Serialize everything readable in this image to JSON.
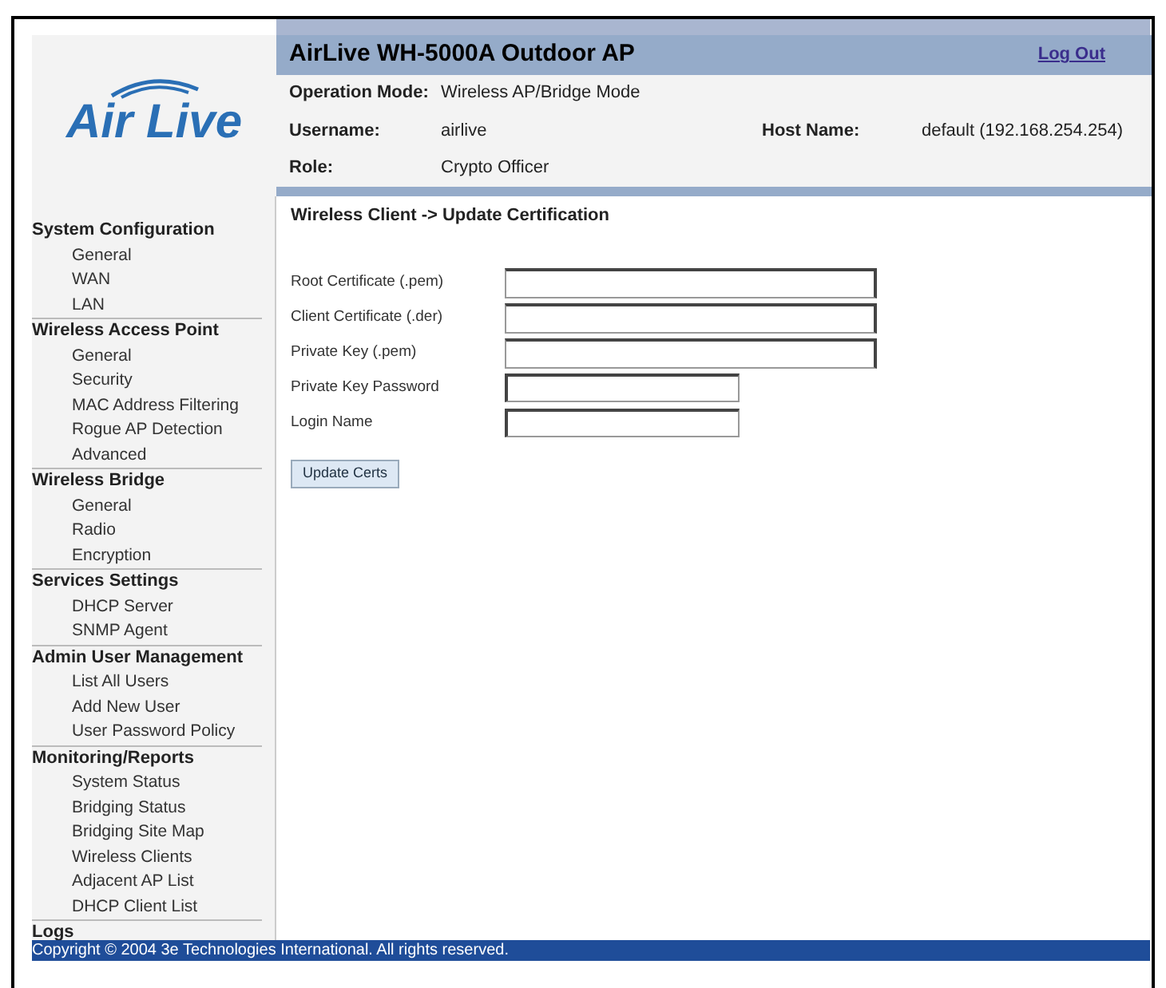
{
  "header": {
    "logo": "Air Live",
    "title": "AirLive WH-5000A  Outdoor AP",
    "logout": "Log Out",
    "info": [
      {
        "label": "Operation Mode:",
        "value": "Wireless AP/Bridge Mode"
      },
      {
        "label": "Username:",
        "value": "airlive",
        "label2": "Host Name:",
        "value2": "default (192.168.254.254)"
      },
      {
        "label": "Role:",
        "value": "Crypto Officer"
      }
    ]
  },
  "sidebar": [
    {
      "title": "System Configuration",
      "items": [
        "General",
        "WAN",
        "LAN"
      ]
    },
    {
      "title": "Wireless Access Point",
      "items": [
        "General",
        "Security",
        "MAC Address Filtering",
        "Rogue AP Detection",
        "Advanced"
      ]
    },
    {
      "title": "Wireless Bridge",
      "items": [
        "General",
        "Radio",
        "Encryption"
      ]
    },
    {
      "title": "Services Settings",
      "items": [
        "DHCP Server",
        "SNMP Agent"
      ]
    },
    {
      "title": "Admin User Management",
      "items": [
        "List All Users",
        "Add New User",
        "User Password Policy"
      ]
    },
    {
      "title": "Monitoring/Reports",
      "items": [
        "System Status",
        "Bridging Status",
        "Bridging Site Map",
        "Wireless Clients",
        "Adjacent AP List",
        "DHCP Client List"
      ]
    },
    {
      "title": "Logs"
    }
  ],
  "content": {
    "heading": "Wireless Client -> Update Certification",
    "fields": [
      {
        "label": "Root Certificate (.pem)",
        "kind": "file"
      },
      {
        "label": "Client Certificate (.der)",
        "kind": "file"
      },
      {
        "label": "Private Key (.pem)",
        "kind": "file"
      },
      {
        "label": "Private Key Password",
        "kind": "text"
      },
      {
        "label": "Login Name",
        "kind": "text"
      }
    ],
    "button": "Update Certs"
  },
  "footer": "Copyright © 2004 3e Technologies International. All rights reserved."
}
